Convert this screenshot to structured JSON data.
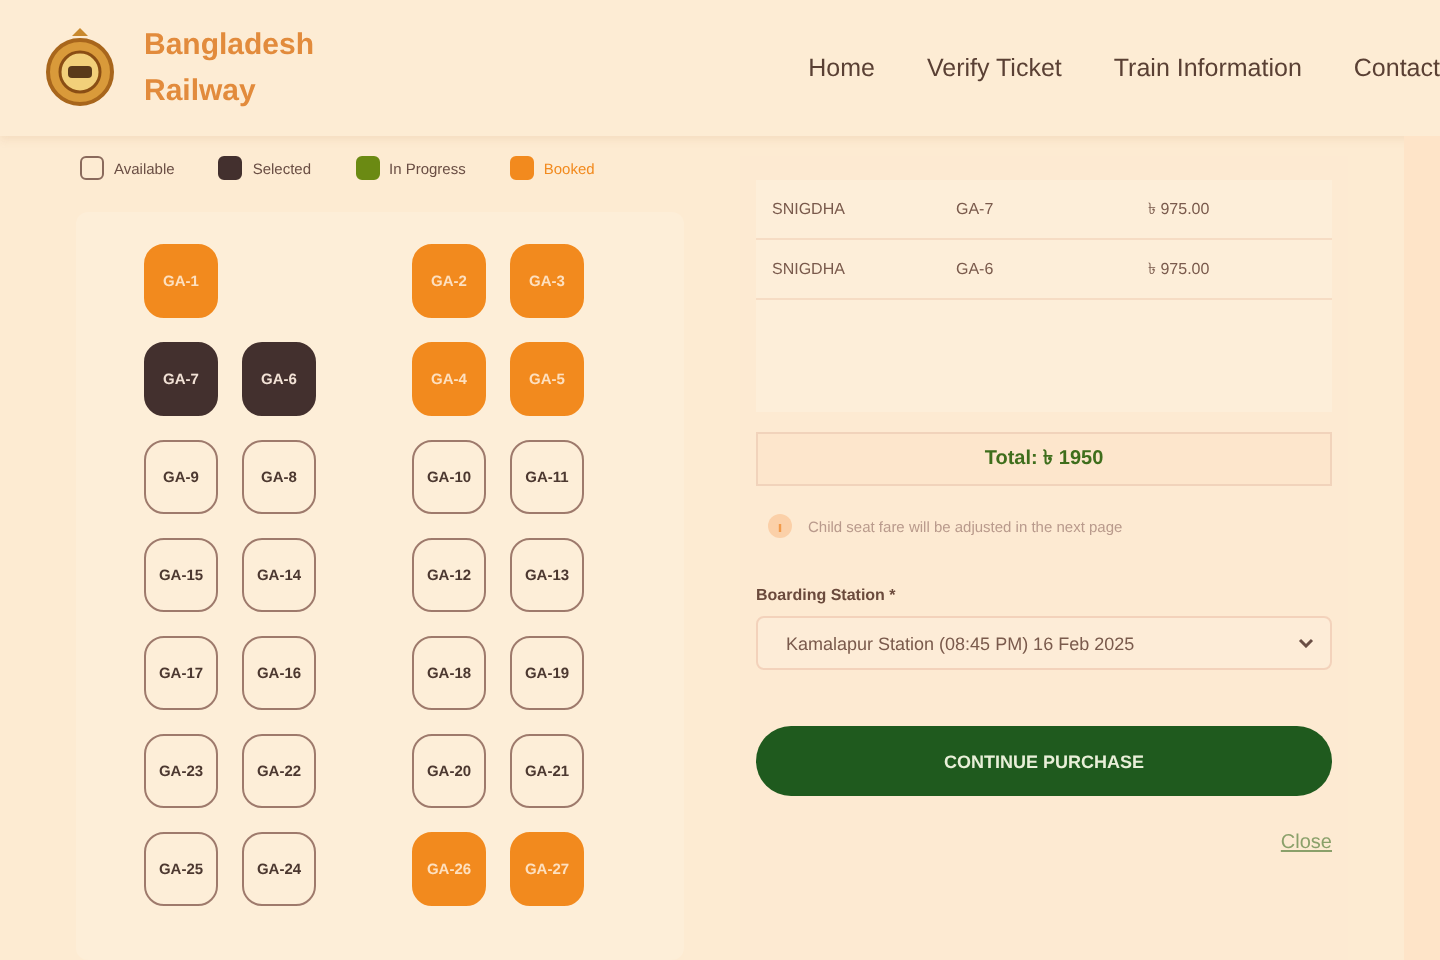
{
  "brand": {
    "line1": "Bangladesh",
    "line2": "Railway"
  },
  "nav": [
    {
      "label": "Home"
    },
    {
      "label": "Verify Ticket"
    },
    {
      "label": "Train Information"
    },
    {
      "label": "Contact"
    }
  ],
  "legend": [
    {
      "label": "Available",
      "kind": "available"
    },
    {
      "label": "Selected",
      "kind": "selected"
    },
    {
      "label": "In Progress",
      "kind": "progress"
    },
    {
      "label": "Booked",
      "kind": "booked"
    }
  ],
  "seat_rows": [
    {
      "left": [
        {
          "label": "GA-1",
          "kind": "booked"
        }
      ],
      "right": [
        {
          "label": "GA-2",
          "kind": "booked"
        },
        {
          "label": "GA-3",
          "kind": "booked"
        }
      ]
    },
    {
      "left": [
        {
          "label": "GA-7",
          "kind": "selected"
        },
        {
          "label": "GA-6",
          "kind": "selected"
        }
      ],
      "right": [
        {
          "label": "GA-4",
          "kind": "booked"
        },
        {
          "label": "GA-5",
          "kind": "booked"
        }
      ]
    },
    {
      "left": [
        {
          "label": "GA-9",
          "kind": "available"
        },
        {
          "label": "GA-8",
          "kind": "available"
        }
      ],
      "right": [
        {
          "label": "GA-10",
          "kind": "available"
        },
        {
          "label": "GA-11",
          "kind": "available"
        }
      ]
    },
    {
      "left": [
        {
          "label": "GA-15",
          "kind": "available"
        },
        {
          "label": "GA-14",
          "kind": "available"
        }
      ],
      "right": [
        {
          "label": "GA-12",
          "kind": "available"
        },
        {
          "label": "GA-13",
          "kind": "available"
        }
      ]
    },
    {
      "left": [
        {
          "label": "GA-17",
          "kind": "available"
        },
        {
          "label": "GA-16",
          "kind": "available"
        }
      ],
      "right": [
        {
          "label": "GA-18",
          "kind": "available"
        },
        {
          "label": "GA-19",
          "kind": "available"
        }
      ]
    },
    {
      "left": [
        {
          "label": "GA-23",
          "kind": "available"
        },
        {
          "label": "GA-22",
          "kind": "available"
        }
      ],
      "right": [
        {
          "label": "GA-20",
          "kind": "available"
        },
        {
          "label": "GA-21",
          "kind": "available"
        }
      ]
    },
    {
      "left": [
        {
          "label": "GA-25",
          "kind": "available"
        },
        {
          "label": "GA-24",
          "kind": "available"
        }
      ],
      "right": [
        {
          "label": "GA-26",
          "kind": "booked"
        },
        {
          "label": "GA-27",
          "kind": "booked"
        }
      ]
    }
  ],
  "selected_seats": [
    {
      "class": "SNIGDHA",
      "seat": "GA-7",
      "fare": "৳ 975.00"
    },
    {
      "class": "SNIGDHA",
      "seat": "GA-6",
      "fare": "৳ 975.00"
    }
  ],
  "total": "Total: ৳ 1950",
  "note": "Child seat fare will be adjusted in the next page",
  "boarding": {
    "label": "Boarding Station *",
    "value": "Kamalapur Station (08:45 PM) 16 Feb 2025"
  },
  "continue_button": "CONTINUE PURCHASE",
  "close_link": "Close"
}
